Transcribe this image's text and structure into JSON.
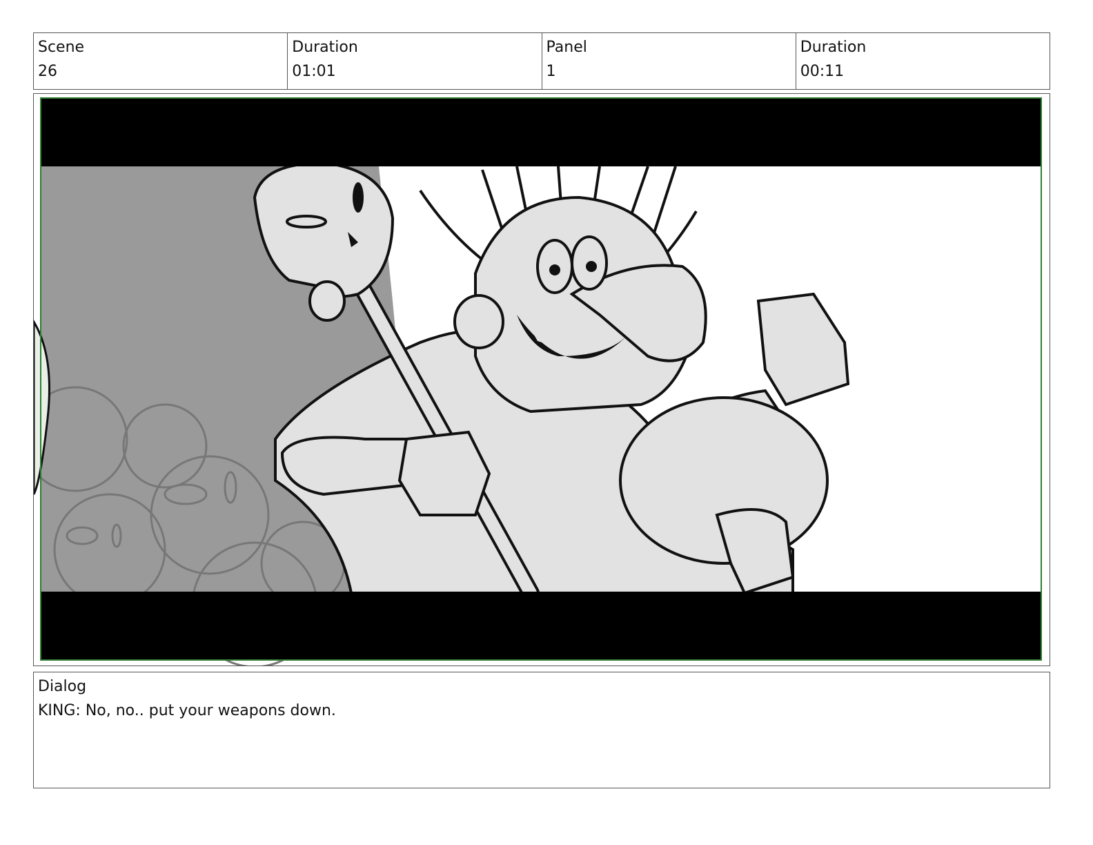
{
  "header": {
    "scene_label": "Scene",
    "scene_value": "26",
    "scene_duration_label": "Duration",
    "scene_duration_value": "01:01",
    "panel_label": "Panel",
    "panel_value": "1",
    "panel_duration_label": "Duration",
    "panel_duration_value": "00:11"
  },
  "dialog": {
    "label": "Dialog",
    "text": "KING: No, no.. put your weapons down."
  },
  "colors": {
    "border": "#555555",
    "letterbox": "#000000",
    "frame_outline": "#2e7d32",
    "background_dark_gray": "#9a9a9a",
    "figure_fill": "#e2e2e2",
    "sketch_line": "#111111"
  }
}
